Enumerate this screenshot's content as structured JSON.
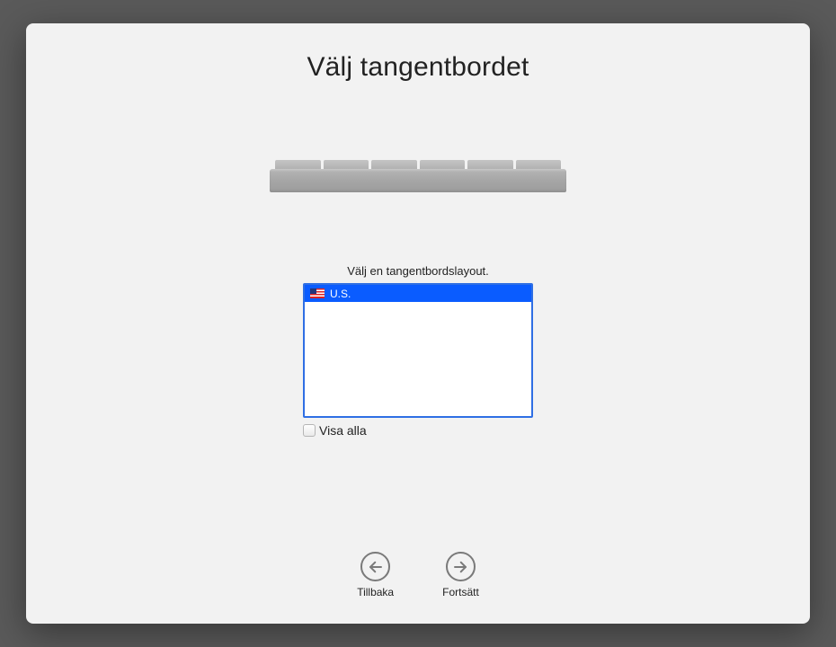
{
  "page": {
    "title": "Välj tangentbordet",
    "section_label": "Välj en tangentbordslayout."
  },
  "keyboard_list": {
    "items": [
      {
        "label": "U.S.",
        "flag": "us",
        "selected": true
      }
    ]
  },
  "show_all": {
    "label": "Visa alla",
    "checked": false
  },
  "nav": {
    "back_label": "Tillbaka",
    "continue_label": "Fortsätt"
  },
  "colors": {
    "selection": "#0a5cff",
    "listbox_border": "#2f6fe4",
    "window_bg": "#f2f2f2"
  }
}
